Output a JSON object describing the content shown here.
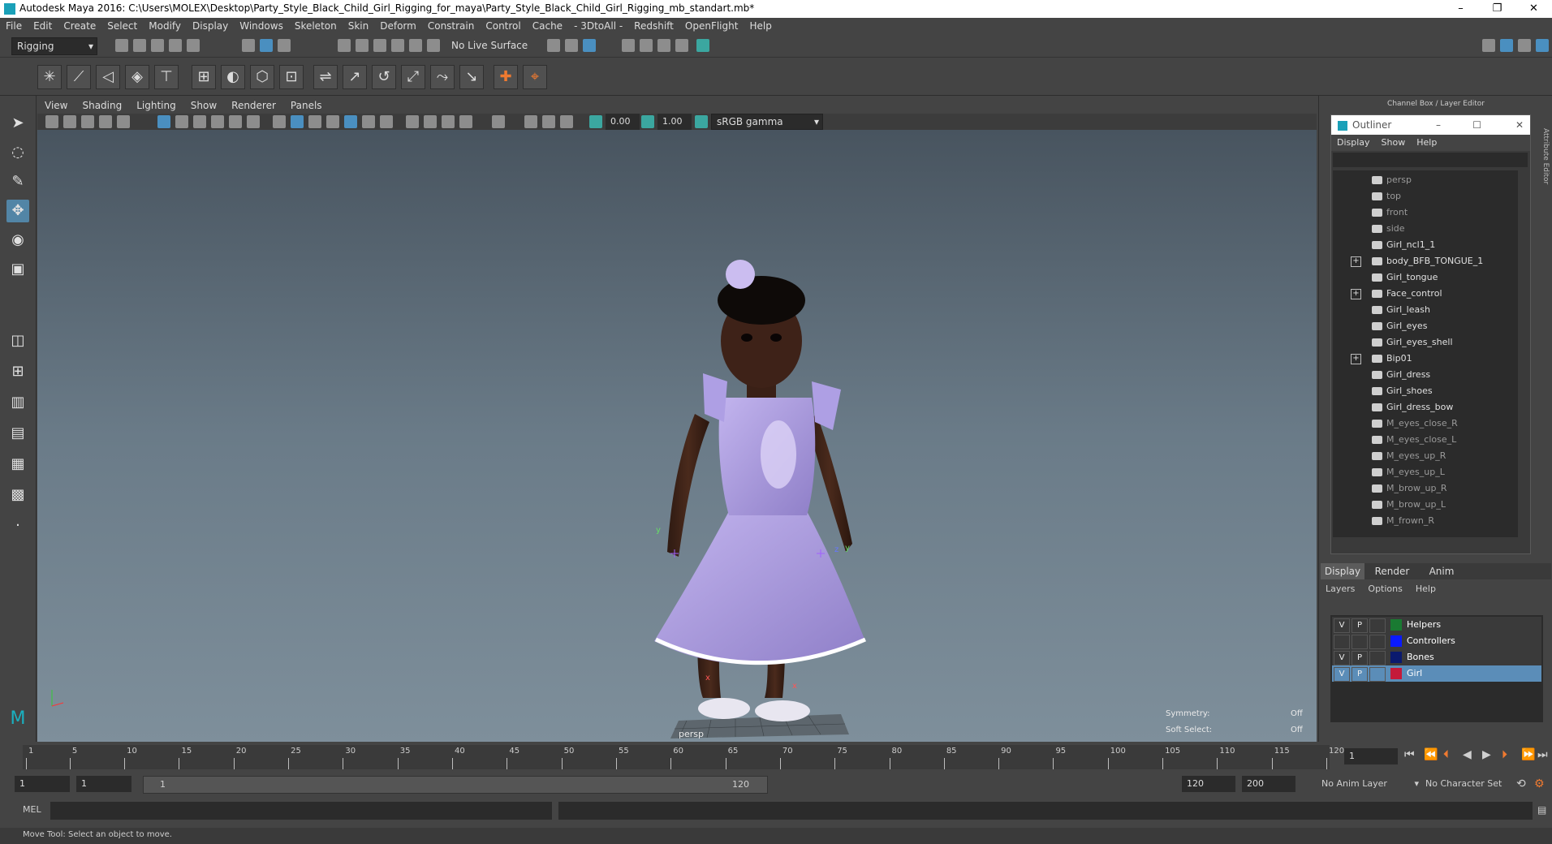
{
  "window": {
    "title": "Autodesk Maya 2016: C:\\Users\\MOLEX\\Desktop\\Party_Style_Black_Child_Girl_Rigging_for_maya\\Party_Style_Black_Child_Girl_Rigging_mb_standart.mb*",
    "minimize": "–",
    "restore": "❐",
    "close": "✕"
  },
  "menubar": [
    "File",
    "Edit",
    "Create",
    "Select",
    "Modify",
    "Display",
    "Windows",
    "Skeleton",
    "Skin",
    "Deform",
    "Constrain",
    "Control",
    "Cache",
    "- 3DtoAll -",
    "Redshift",
    "OpenFlight",
    "Help"
  ],
  "statusline": {
    "mode": "Rigging",
    "live_surface": "No Live Surface"
  },
  "viewport": {
    "menu": [
      "View",
      "Shading",
      "Lighting",
      "Show",
      "Renderer",
      "Panels"
    ],
    "exposure": "0.00",
    "gamma": "1.00",
    "color_space": "sRGB gamma",
    "camera_label": "persp",
    "hud": {
      "symmetry_label": "Symmetry:",
      "symmetry_value": "Off",
      "soft_select_label": "Soft Select:",
      "soft_select_value": "Off"
    },
    "axis_labels": {
      "x": "x",
      "y": "y",
      "z": "z"
    }
  },
  "right_panel": {
    "header": "Channel Box / Layer Editor",
    "side_tab_attr": "Attribute Editor",
    "side_tab_channel": "Channel Box / Layer Editor"
  },
  "outliner": {
    "title": "Outliner",
    "menu": [
      "Display",
      "Show",
      "Help"
    ],
    "items": [
      {
        "label": "persp",
        "dim": true,
        "expand": false
      },
      {
        "label": "top",
        "dim": true,
        "expand": false
      },
      {
        "label": "front",
        "dim": true,
        "expand": false
      },
      {
        "label": "side",
        "dim": true,
        "expand": false
      },
      {
        "label": "Girl_ncl1_1",
        "dim": false,
        "expand": false
      },
      {
        "label": "body_BFB_TONGUE_1",
        "dim": false,
        "expand": true
      },
      {
        "label": "Girl_tongue",
        "dim": false,
        "expand": false
      },
      {
        "label": "Face_control",
        "dim": false,
        "expand": true
      },
      {
        "label": "Girl_leash",
        "dim": false,
        "expand": false
      },
      {
        "label": "Girl_eyes",
        "dim": false,
        "expand": false
      },
      {
        "label": "Girl_eyes_shell",
        "dim": false,
        "expand": false
      },
      {
        "label": "Bip01",
        "dim": false,
        "expand": true
      },
      {
        "label": "Girl_dress",
        "dim": false,
        "expand": false
      },
      {
        "label": "Girl_shoes",
        "dim": false,
        "expand": false
      },
      {
        "label": "Girl_dress_bow",
        "dim": false,
        "expand": false
      },
      {
        "label": "M_eyes_close_R",
        "dim": true,
        "expand": false
      },
      {
        "label": "M_eyes_close_L",
        "dim": true,
        "expand": false
      },
      {
        "label": "M_eyes_up_R",
        "dim": true,
        "expand": false
      },
      {
        "label": "M_eyes_up_L",
        "dim": true,
        "expand": false
      },
      {
        "label": "M_brow_up_R",
        "dim": true,
        "expand": false
      },
      {
        "label": "M_brow_up_L",
        "dim": true,
        "expand": false
      },
      {
        "label": "M_frown_R",
        "dim": true,
        "expand": false
      }
    ]
  },
  "layer_editor": {
    "tabs": [
      "Display",
      "Render",
      "Anim"
    ],
    "menu": [
      "Layers",
      "Options",
      "Help"
    ],
    "layers": [
      {
        "v": "V",
        "p": "P",
        "color": "#1a7a32",
        "name": "Helpers",
        "selected": false
      },
      {
        "v": "",
        "p": "",
        "color": "#0a1aff",
        "name": "Controllers",
        "selected": false
      },
      {
        "v": "V",
        "p": "P",
        "color": "#0b1a6e",
        "name": "Bones",
        "selected": false
      },
      {
        "v": "V",
        "p": "P",
        "color": "#c41a3a",
        "name": "Girl",
        "selected": true
      }
    ]
  },
  "timeline": {
    "ticks": [
      "1",
      "5",
      "10",
      "15",
      "20",
      "25",
      "30",
      "35",
      "40",
      "45",
      "50",
      "55",
      "60",
      "65",
      "70",
      "75",
      "80",
      "85",
      "90",
      "95",
      "100",
      "105",
      "110",
      "115",
      "120"
    ],
    "current_frame": "1"
  },
  "range": {
    "start": "1",
    "playback_start": "1",
    "slider_start": "1",
    "slider_end": "120",
    "playback_end": "120",
    "end": "200",
    "anim_layer": "No Anim Layer",
    "char_set": "No Character Set"
  },
  "command_line": {
    "label": "MEL"
  },
  "help_line": "Move Tool: Select an object to move."
}
